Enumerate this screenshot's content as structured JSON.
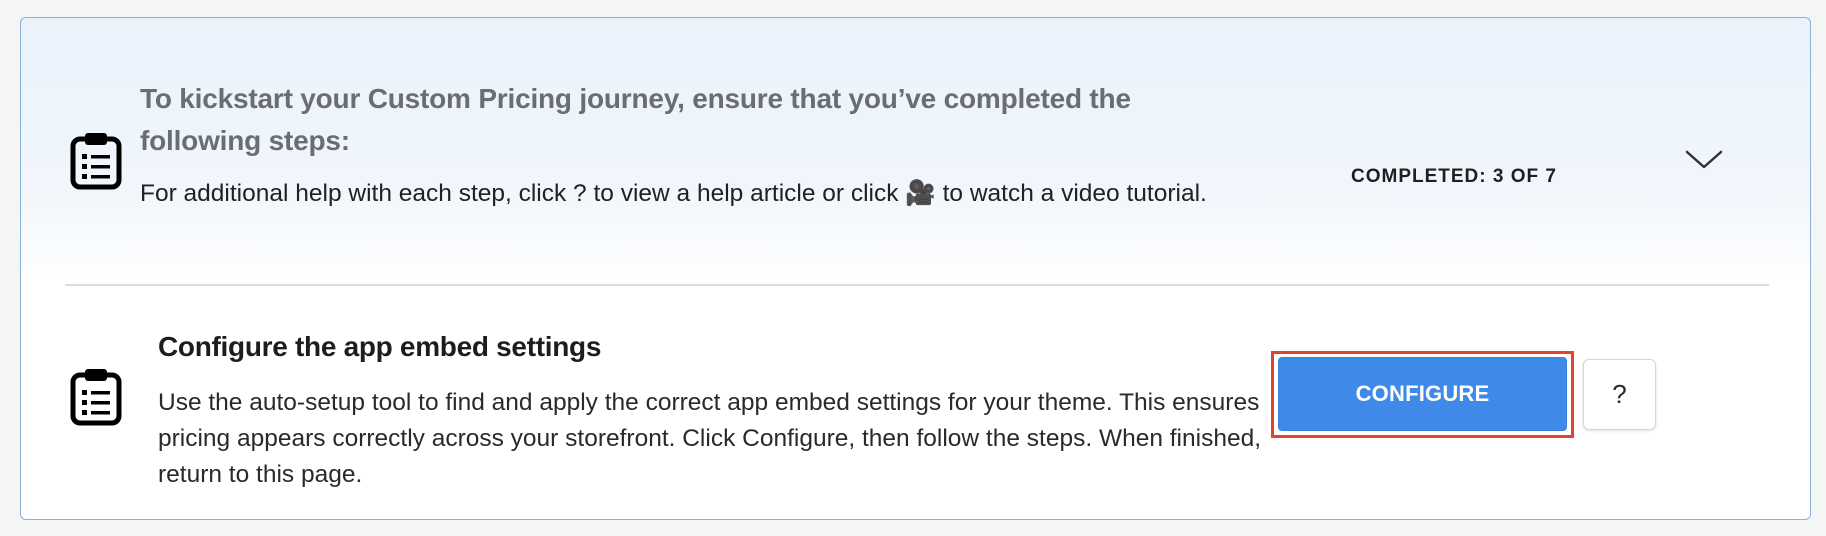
{
  "header": {
    "title": "To kickstart your Custom Pricing journey, ensure that you’ve completed the following steps:",
    "subtitle": "For additional help with each step, click ? to view a help article or click 🎥 to watch a video tutorial.",
    "progress_text": "COMPLETED: 3 OF 7",
    "icon": "clipboard-list-icon",
    "toggle_icon": "chevron-down-icon"
  },
  "step": {
    "title": "Configure the app embed settings",
    "description": "Use the auto-setup tool to find and apply the correct app embed settings for your theme. This ensures pricing appears correctly across your storefront. Click Configure, then follow the steps. When finished, return to this page.",
    "icon": "clipboard-list-icon",
    "configure_label": "CONFIGURE",
    "help_label": "?"
  },
  "colors": {
    "accent": "#3f8ae8",
    "highlight_outline": "#e0442f",
    "card_border": "#8cb0d6"
  }
}
